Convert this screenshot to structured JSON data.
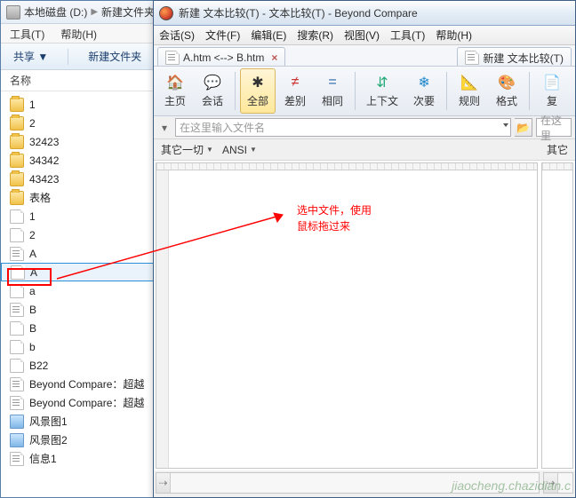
{
  "explorer": {
    "breadcrumb": {
      "disk": "本地磁盘 (D:)",
      "folder": "新建文件夹"
    },
    "menu": {
      "tools": "工具(T)",
      "help": "帮助(H)"
    },
    "toolbar": {
      "share": "共享 ▼",
      "newfolder": "新建文件夹"
    },
    "column_name": "名称",
    "files": [
      {
        "name": "1",
        "type": "folder"
      },
      {
        "name": "2",
        "type": "folder"
      },
      {
        "name": "32423",
        "type": "folder"
      },
      {
        "name": "34342",
        "type": "folder"
      },
      {
        "name": "43423",
        "type": "folder"
      },
      {
        "name": "表格",
        "type": "folder"
      },
      {
        "name": "1",
        "type": "file"
      },
      {
        "name": "2",
        "type": "file"
      },
      {
        "name": "A",
        "type": "filelines"
      },
      {
        "name": "A",
        "type": "file",
        "selected": true
      },
      {
        "name": "a",
        "type": "file"
      },
      {
        "name": "B",
        "type": "filelines"
      },
      {
        "name": "B",
        "type": "file"
      },
      {
        "name": "b",
        "type": "file"
      },
      {
        "name": "B22",
        "type": "file"
      },
      {
        "name": "Beyond Compare：超越",
        "type": "filelines"
      },
      {
        "name": "Beyond Compare：超越",
        "type": "filelines"
      },
      {
        "name": "风景图1",
        "type": "pic"
      },
      {
        "name": "风景图2",
        "type": "pic"
      },
      {
        "name": "信息1",
        "type": "filelines"
      }
    ]
  },
  "bc": {
    "title": "新建 文本比较(T) - 文本比较(T) - Beyond Compare",
    "menu": {
      "session": "会话(S)",
      "file": "文件(F)",
      "edit": "编辑(E)",
      "search": "搜索(R)",
      "view": "视图(V)",
      "tools": "工具(T)",
      "help": "帮助(H)"
    },
    "tabs": {
      "left": "A.htm <--> B.htm",
      "right": "新建 文本比较(T)"
    },
    "toolbar": {
      "home": "主页",
      "session": "会话",
      "all": "全部",
      "diff": "差别",
      "same": "相同",
      "context": "上下文",
      "minor": "次要",
      "rules": "规则",
      "format": "格式",
      "copy": "复"
    },
    "path_placeholder_left": "在这里输入文件名",
    "path_placeholder_right": "在这里",
    "filter": {
      "leftmisc": "其它一切",
      "encoding": "ANSI",
      "rightmisc": "其它"
    }
  },
  "annotation": {
    "line1": "选中文件，使用",
    "line2": "鼠标拖过来"
  },
  "watermark": "jiaocheng.chazidian.c"
}
